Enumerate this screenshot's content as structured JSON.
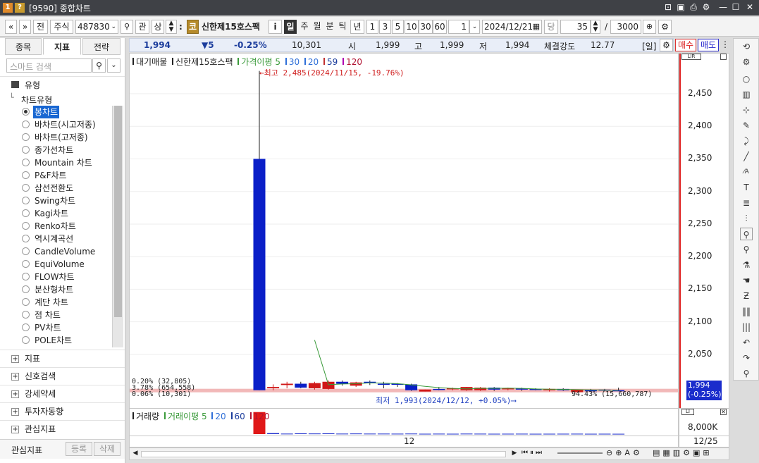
{
  "window": {
    "badge1": "1",
    "badge2": "?",
    "title": "[9590] 종합차트"
  },
  "toolbar": {
    "nav_prev": "«",
    "nav_down": "»",
    "jeon": "전",
    "market": "주식",
    "code": "487830",
    "search_icon": "search-icon",
    "gwan": "관",
    "sang": "상",
    "stock_badge": "코",
    "stock_name": "신한제15호스팩",
    "info_btn": "i",
    "periods": [
      "일",
      "주",
      "월",
      "분",
      "틱",
      "년"
    ],
    "period_selected": "일",
    "nums": [
      "1",
      "3",
      "5",
      "10",
      "30",
      "60"
    ],
    "minute_value": "1",
    "date": "2024/12/21",
    "dang": "당",
    "count": "35",
    "slash": "/",
    "total": "3000"
  },
  "left": {
    "tabs": [
      "종목",
      "지표",
      "전략"
    ],
    "tab_selected": "지표",
    "search_placeholder": "스마트 검색",
    "type_section": "유형",
    "chart_type_group": "차트유형",
    "chart_types": [
      "봉차트",
      "바차트(시고저종)",
      "바차트(고저종)",
      "종가선차트",
      "Mountain 차트",
      "P&F차트",
      "삼선전환도",
      "Swing차트",
      "Kagi차트",
      "Renko차트",
      "역시계곡선",
      "CandleVolume",
      "EquiVolume",
      "FLOW차트",
      "분산형차트",
      "계단 차트",
      "점 차트",
      "PV차트",
      "POLE차트"
    ],
    "selected_type": "봉차트",
    "sections": [
      "지표",
      "신호검색",
      "강세약세",
      "투자자동향",
      "관심지표"
    ],
    "footer_label": "관심지표",
    "register": "등록",
    "delete": "삭제"
  },
  "infobar": {
    "price": "1,994",
    "change": "▼5",
    "pct": "-0.25%",
    "volume": "10,301",
    "open_label": "시",
    "open": "1,999",
    "high_label": "고",
    "high": "1,999",
    "low_label": "저",
    "low": "1,994",
    "strength_label": "체결강도",
    "strength": "12.77",
    "period_tag": "[일]",
    "buy": "매수",
    "sell": "매도"
  },
  "legend": {
    "name1": "대기매물",
    "name2": "신한제15호스팩",
    "ma_label": "가격이평",
    "ma": [
      "5",
      "30",
      "20",
      "59",
      "120"
    ],
    "ma_colors": [
      "#3a9a3a",
      "#2f6fd8",
      "#2f6fd8",
      "#c03030",
      "#b000b0"
    ]
  },
  "annotations": {
    "high_note": "←최고 2,485(2024/11/15, -19.76%)",
    "low_note": "최저 1,993(2024/12/12, +0.05%)⟶",
    "profile": [
      "0.20% (32,805)",
      "3.78% (654,558)",
      "0.06% (10,301)"
    ],
    "profile_right": "94.43% (15,660,787)"
  },
  "yaxis": {
    "ticks": [
      "2,450",
      "2,400",
      "2,350",
      "2,300",
      "2,250",
      "2,200",
      "2,150",
      "2,100",
      "2,050"
    ],
    "current": "1,994",
    "current_pct": "(-0.25%)"
  },
  "volume_panel": {
    "title": "거래량",
    "ma_label": "거래이평",
    "ma": [
      "5",
      "20",
      "60",
      "120"
    ],
    "axis": "8,000K",
    "date_axis": "12/25"
  },
  "xaxis": {
    "label": "12"
  },
  "chart_data": {
    "type": "candlestick",
    "ylim": [
      1985,
      2490
    ],
    "candles": [
      {
        "o": 1995,
        "h": 2485,
        "l": 1995,
        "c": 2350,
        "color": "blue"
      },
      {
        "o": 1998,
        "h": 2004,
        "l": 1995,
        "c": 2000,
        "color": "red"
      },
      {
        "o": 2003,
        "h": 2008,
        "l": 1998,
        "c": 2005,
        "color": "red"
      },
      {
        "o": 2005,
        "h": 2008,
        "l": 1998,
        "c": 1999,
        "color": "blue"
      },
      {
        "o": 1998,
        "h": 2008,
        "l": 1996,
        "c": 2006,
        "color": "red"
      },
      {
        "o": 1997,
        "h": 2010,
        "l": 1996,
        "c": 2008,
        "color": "red"
      },
      {
        "o": 2008,
        "h": 2010,
        "l": 2002,
        "c": 2005,
        "color": "blue"
      },
      {
        "o": 2002,
        "h": 2008,
        "l": 2000,
        "c": 2007,
        "color": "red"
      },
      {
        "o": 2008,
        "h": 2010,
        "l": 2003,
        "c": 2006,
        "color": "blue"
      },
      {
        "o": 2005,
        "h": 2008,
        "l": 1998,
        "c": 2004,
        "color": "blue"
      },
      {
        "o": 2005,
        "h": 2006,
        "l": 2000,
        "c": 2004,
        "color": "blue"
      },
      {
        "o": 2004,
        "h": 2005,
        "l": 1994,
        "c": 1995,
        "color": "blue"
      },
      {
        "o": 1993,
        "h": 1996,
        "l": 1993,
        "c": 1996,
        "color": "red"
      },
      {
        "o": 1997,
        "h": 2000,
        "l": 1995,
        "c": 1996,
        "color": "blue"
      },
      {
        "o": 1997,
        "h": 1999,
        "l": 1995,
        "c": 1998,
        "color": "red"
      },
      {
        "o": 1995,
        "h": 2000,
        "l": 1994,
        "c": 2000,
        "color": "red"
      },
      {
        "o": 1995,
        "h": 2000,
        "l": 1994,
        "c": 1999,
        "color": "red"
      },
      {
        "o": 1999,
        "h": 2000,
        "l": 1994,
        "c": 1996,
        "color": "blue"
      },
      {
        "o": 1997,
        "h": 1999,
        "l": 1995,
        "c": 1998,
        "color": "red"
      },
      {
        "o": 1998,
        "h": 1999,
        "l": 1994,
        "c": 1996,
        "color": "blue"
      },
      {
        "o": 1997,
        "h": 1998,
        "l": 1995,
        "c": 1996,
        "color": "blue"
      },
      {
        "o": 1995,
        "h": 1998,
        "l": 1993,
        "c": 1997,
        "color": "red"
      },
      {
        "o": 1997,
        "h": 1998,
        "l": 1994,
        "c": 1995,
        "color": "blue"
      },
      {
        "o": 1992,
        "h": 1996,
        "l": 1992,
        "c": 1996,
        "color": "red"
      },
      {
        "o": 1995,
        "h": 1997,
        "l": 1993,
        "c": 1994,
        "color": "blue"
      },
      {
        "o": 1996,
        "h": 1997,
        "l": 1993,
        "c": 1995,
        "color": "blue"
      },
      {
        "o": 1995,
        "h": 1999,
        "l": 1994,
        "c": 1994,
        "color": "blue"
      }
    ],
    "volume_ylim": [
      0,
      10000
    ],
    "volumes": [
      9200,
      400,
      200,
      300,
      250,
      300,
      200,
      250,
      200,
      200,
      180,
      220,
      150,
      180,
      150,
      200,
      180,
      150,
      160,
      170,
      140,
      150,
      160,
      170,
      140,
      150,
      130
    ]
  }
}
